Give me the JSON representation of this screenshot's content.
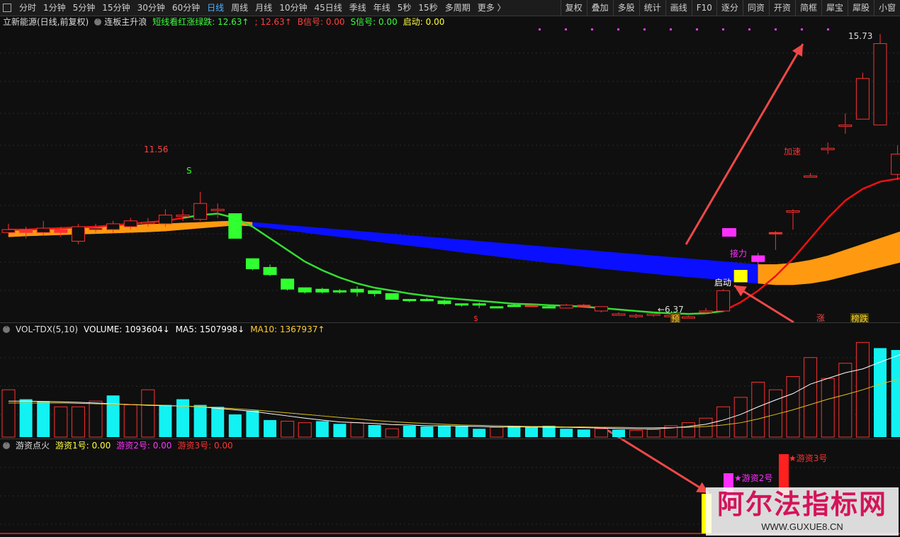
{
  "toolbar": {
    "periods": [
      "分时",
      "1分钟",
      "5分钟",
      "15分钟",
      "30分钟",
      "60分钟",
      "日线",
      "周线",
      "月线",
      "10分钟",
      "45日线",
      "季线",
      "年线",
      "5秒",
      "15秒",
      "多周期",
      "更多 〉"
    ],
    "active_period": "日线",
    "right_buttons": [
      "复权",
      "叠加",
      "多股",
      "统计",
      "画线",
      "F10",
      "逐分",
      "同资",
      "开资",
      "简框",
      "犀宝",
      "犀股",
      "小窗"
    ]
  },
  "main_panel": {
    "stock_title": "立新能源(日线,前复权)",
    "indicator_name": "连板主升浪",
    "fields": [
      {
        "label": "短线看红涨绿跌: 12.63↑",
        "color": "#3cff3c"
      },
      {
        "label": "; 12.63↑",
        "color": "#ff4040"
      },
      {
        "label": "B信号: 0.00",
        "color": "#ff4040"
      },
      {
        "label": "S信号: 0.00",
        "color": "#3cff3c"
      },
      {
        "label": "启动: 0.00",
        "color": "#ffff40"
      }
    ],
    "annotations": {
      "high_left": "11.56",
      "high_right": "15.73",
      "low": "6.37",
      "s_signal": "S",
      "s_marker": "$",
      "start": "启动",
      "relay": "接力",
      "accelerate": "加速",
      "pre": "预",
      "up": "涨",
      "list_down": "榜跌"
    }
  },
  "volume_panel": {
    "title": "VOL-TDX(5,10)",
    "volume": "VOLUME: 1093604↓",
    "ma5": "MA5: 1507998↓",
    "ma10": "MA10: 1367937↑"
  },
  "fire_panel": {
    "title": "游资点火",
    "f1": "游资1号: 0.00",
    "f2": "游资2号: 0.00",
    "f3": "游资3号: 0.00",
    "label2": "★游资2号",
    "label3": "★游资3号"
  },
  "watermark": {
    "main": "阿尔法指标网",
    "sub": "WWW.GUXUE8.CN"
  },
  "chart_data": {
    "type": "candlestick",
    "candles": [
      {
        "o": 8.9,
        "c": 9.0,
        "h": 9.2,
        "l": 8.8
      },
      {
        "o": 9.0,
        "c": 8.9,
        "h": 9.1,
        "l": 8.7
      },
      {
        "o": 8.9,
        "c": 9.05,
        "h": 9.3,
        "l": 8.8
      },
      {
        "o": 9.0,
        "c": 8.9,
        "h": 9.1,
        "l": 8.75
      },
      {
        "o": 8.6,
        "c": 9.1,
        "h": 9.2,
        "l": 8.5
      },
      {
        "o": 9.0,
        "c": 9.05,
        "h": 9.2,
        "l": 8.9
      },
      {
        "o": 9.0,
        "c": 9.2,
        "h": 9.3,
        "l": 8.9
      },
      {
        "o": 9.1,
        "c": 9.3,
        "h": 9.4,
        "l": 9.0
      },
      {
        "o": 9.2,
        "c": 9.25,
        "h": 9.4,
        "l": 9.1
      },
      {
        "o": 9.2,
        "c": 9.5,
        "h": 9.7,
        "l": 9.1
      },
      {
        "o": 9.5,
        "c": 9.5,
        "h": 9.7,
        "l": 9.3
      },
      {
        "o": 9.35,
        "c": 9.9,
        "h": 10.3,
        "l": 9.3
      },
      {
        "o": 9.7,
        "c": 9.7,
        "h": 9.9,
        "l": 9.4
      },
      {
        "o": 9.55,
        "c": 8.7,
        "h": 9.55,
        "l": 8.7
      },
      {
        "o": 8.0,
        "c": 7.65,
        "h": 8.0,
        "l": 7.6
      },
      {
        "o": 7.7,
        "c": 7.45,
        "h": 7.8,
        "l": 7.4
      },
      {
        "o": 7.3,
        "c": 6.95,
        "h": 7.3,
        "l": 6.9
      },
      {
        "o": 7.0,
        "c": 6.85,
        "h": 7.0,
        "l": 6.8
      },
      {
        "o": 6.95,
        "c": 6.85,
        "h": 7.0,
        "l": 6.8
      },
      {
        "o": 6.9,
        "c": 6.85,
        "h": 6.95,
        "l": 6.8
      },
      {
        "o": 6.95,
        "c": 6.85,
        "h": 7.05,
        "l": 6.7
      },
      {
        "o": 6.9,
        "c": 6.8,
        "h": 6.9,
        "l": 6.7
      },
      {
        "o": 6.8,
        "c": 6.6,
        "h": 6.8,
        "l": 6.6
      },
      {
        "o": 6.6,
        "c": 6.6,
        "h": 6.6,
        "l": 6.5
      },
      {
        "o": 6.6,
        "c": 6.55,
        "h": 6.65,
        "l": 6.55
      },
      {
        "o": 6.55,
        "c": 6.45,
        "h": 6.6,
        "l": 6.4
      },
      {
        "o": 6.45,
        "c": 6.4,
        "h": 6.45,
        "l": 6.35
      },
      {
        "o": 6.45,
        "c": 6.4,
        "h": 6.5,
        "l": 6.3
      },
      {
        "o": 6.35,
        "c": 6.35,
        "h": 6.35,
        "l": 6.3
      },
      {
        "o": 6.35,
        "c": 6.4,
        "h": 6.45,
        "l": 6.35
      },
      {
        "o": 6.4,
        "c": 6.35,
        "h": 6.4,
        "l": 6.35
      },
      {
        "o": 6.35,
        "c": 6.3,
        "h": 6.4,
        "l": 6.3
      },
      {
        "o": 6.3,
        "c": 6.4,
        "h": 6.45,
        "l": 6.3
      },
      {
        "o": 6.4,
        "c": 6.35,
        "h": 6.45,
        "l": 6.3
      },
      {
        "o": 6.2,
        "c": 6.35,
        "h": 6.35,
        "l": 6.15
      },
      {
        "o": 6.05,
        "c": 6.1,
        "h": 6.15,
        "l": 6.05
      },
      {
        "o": 6.0,
        "c": 6.05,
        "h": 6.1,
        "l": 5.95
      },
      {
        "o": 6.05,
        "c": 6.1,
        "h": 6.1,
        "l": 6.0
      },
      {
        "o": 6.0,
        "c": 6.05,
        "h": 6.1,
        "l": 5.95
      },
      {
        "o": 5.95,
        "c": 6.0,
        "h": 6.05,
        "l": 5.95
      },
      {
        "o": 6.15,
        "c": 6.2,
        "h": 6.3,
        "l": 6.1
      },
      {
        "o": 6.2,
        "c": 6.9,
        "h": 6.95,
        "l": 6.15
      },
      {
        "o": 7.6,
        "c": 7.2,
        "h": 7.6,
        "l": 7.2
      },
      {
        "o": 8.1,
        "c": 7.9,
        "h": 8.2,
        "l": 7.8
      },
      {
        "o": 8.9,
        "c": 8.85,
        "h": 8.95,
        "l": 8.3
      },
      {
        "o": 9.6,
        "c": 9.65,
        "h": 9.7,
        "l": 9.0
      },
      {
        "o": 10.85,
        "c": 10.85,
        "h": 10.95,
        "l": 10.8
      },
      {
        "o": 11.75,
        "c": 11.8,
        "h": 12.0,
        "l": 11.6
      },
      {
        "o": 12.6,
        "c": 12.6,
        "h": 13.0,
        "l": 12.3
      },
      {
        "o": 12.8,
        "c": 14.2,
        "h": 14.4,
        "l": 12.8
      },
      {
        "o": 12.6,
        "c": 15.4,
        "h": 15.73,
        "l": 12.6
      },
      {
        "o": 10.9,
        "c": 11.6,
        "h": 11.9,
        "l": 10.7
      },
      {
        "o": 11.3,
        "c": 11.0,
        "h": 11.6,
        "l": 10.9
      },
      {
        "o": 11.2,
        "c": 10.4,
        "h": 11.6,
        "l": 10.4
      }
    ],
    "candle_colors": [
      "r",
      "r",
      "r",
      "r",
      "r",
      "r",
      "r",
      "r",
      "r",
      "r",
      "r",
      "r",
      "r",
      "g",
      "g",
      "g",
      "g",
      "g",
      "g",
      "g",
      "g",
      "g",
      "g",
      "g",
      "g",
      "g",
      "g",
      "g",
      "g",
      "g",
      "r",
      "g",
      "r",
      "r",
      "r",
      "r",
      "r",
      "r",
      "r",
      "r",
      "r",
      "r",
      "y",
      "m",
      "r",
      "r",
      "r",
      "r",
      "r",
      "r",
      "r",
      "r",
      "r",
      "r"
    ],
    "ma_line": [
      9.0,
      9.0,
      9.03,
      9.05,
      9.08,
      9.1,
      9.15,
      9.2,
      9.25,
      9.3,
      9.4,
      9.5,
      9.55,
      9.4,
      9.1,
      8.7,
      8.3,
      7.9,
      7.6,
      7.35,
      7.15,
      7.0,
      6.9,
      6.8,
      6.72,
      6.65,
      6.6,
      6.55,
      6.5,
      6.45,
      6.43,
      6.4,
      6.38,
      6.35,
      6.3,
      6.25,
      6.2,
      6.15,
      6.12,
      6.1,
      6.12,
      6.2,
      6.5,
      6.9,
      7.4,
      8.0,
      8.7,
      9.4,
      10.0,
      10.4,
      10.65,
      10.75,
      10.8,
      10.8
    ],
    "cloud_upper": [
      8.95,
      9.0,
      9.02,
      9.05,
      9.08,
      9.1,
      9.13,
      9.15,
      9.18,
      9.2,
      9.23,
      9.25,
      9.28,
      9.3,
      9.25,
      9.2,
      9.15,
      9.1,
      9.05,
      9.0,
      8.95,
      8.9,
      8.85,
      8.8,
      8.75,
      8.7,
      8.65,
      8.6,
      8.55,
      8.5,
      8.45,
      8.4,
      8.35,
      8.3,
      8.25,
      8.2,
      8.15,
      8.1,
      8.05,
      8.0,
      7.95,
      7.9,
      7.85,
      7.8,
      7.8,
      7.85,
      7.95,
      8.1,
      8.3,
      8.5,
      8.7,
      8.9,
      9.1,
      9.3
    ],
    "cloud_lower": [
      8.75,
      8.78,
      8.8,
      8.82,
      8.84,
      8.86,
      8.88,
      8.9,
      8.92,
      8.95,
      9.0,
      9.05,
      9.1,
      9.15,
      9.12,
      9.05,
      8.98,
      8.9,
      8.82,
      8.75,
      8.68,
      8.6,
      8.52,
      8.45,
      8.38,
      8.3,
      8.22,
      8.15,
      8.08,
      8.0,
      7.93,
      7.86,
      7.8,
      7.73,
      7.66,
      7.6,
      7.54,
      7.48,
      7.42,
      7.37,
      7.32,
      7.27,
      7.2,
      7.15,
      7.1,
      7.1,
      7.15,
      7.25,
      7.4,
      7.55,
      7.7,
      7.85,
      8.0,
      8.15
    ],
    "volume": [
      1.25,
      1.0,
      0.95,
      0.8,
      0.8,
      0.95,
      1.1,
      0.85,
      1.25,
      0.85,
      1.0,
      0.85,
      0.8,
      0.6,
      0.7,
      0.45,
      0.42,
      0.38,
      0.42,
      0.35,
      0.38,
      0.32,
      0.22,
      0.3,
      0.28,
      0.3,
      0.3,
      0.22,
      0.26,
      0.3,
      0.28,
      0.3,
      0.22,
      0.2,
      0.22,
      0.2,
      0.18,
      0.2,
      0.3,
      0.38,
      0.5,
      0.8,
      1.05,
      1.45,
      1.25,
      1.6,
      2.1,
      1.55,
      1.95,
      2.5,
      2.35,
      2.3,
      2.3,
      2.1
    ],
    "vol_colors": [
      "r",
      "c",
      "c",
      "r",
      "r",
      "r",
      "c",
      "r",
      "r",
      "c",
      "c",
      "c",
      "c",
      "c",
      "c",
      "c",
      "r",
      "r",
      "c",
      "c",
      "r",
      "c",
      "r",
      "c",
      "c",
      "c",
      "c",
      "c",
      "r",
      "c",
      "c",
      "c",
      "c",
      "c",
      "r",
      "c",
      "r",
      "r",
      "r",
      "r",
      "r",
      "r",
      "r",
      "r",
      "r",
      "r",
      "r",
      "r",
      "r",
      "r",
      "c",
      "c",
      "r",
      "y"
    ],
    "vol_ma5": [
      0.95,
      0.95,
      0.94,
      0.93,
      0.92,
      0.9,
      0.88,
      0.86,
      0.84,
      0.83,
      0.82,
      0.8,
      0.76,
      0.72,
      0.68,
      0.62,
      0.56,
      0.5,
      0.45,
      0.4,
      0.38,
      0.36,
      0.33,
      0.32,
      0.3,
      0.3,
      0.29,
      0.28,
      0.27,
      0.27,
      0.27,
      0.26,
      0.26,
      0.25,
      0.24,
      0.23,
      0.22,
      0.22,
      0.24,
      0.28,
      0.34,
      0.45,
      0.6,
      0.8,
      0.98,
      1.15,
      1.4,
      1.55,
      1.7,
      1.8,
      1.98,
      2.15,
      2.35,
      2.2
    ],
    "vol_ma10": [
      0.9,
      0.9,
      0.9,
      0.9,
      0.89,
      0.88,
      0.87,
      0.86,
      0.85,
      0.84,
      0.82,
      0.8,
      0.78,
      0.75,
      0.72,
      0.68,
      0.64,
      0.6,
      0.56,
      0.52,
      0.48,
      0.44,
      0.41,
      0.38,
      0.36,
      0.34,
      0.32,
      0.31,
      0.3,
      0.29,
      0.28,
      0.28,
      0.27,
      0.27,
      0.26,
      0.26,
      0.25,
      0.25,
      0.25,
      0.26,
      0.28,
      0.32,
      0.38,
      0.48,
      0.6,
      0.72,
      0.86,
      1.0,
      1.12,
      1.25,
      1.4,
      1.52,
      1.62,
      1.7
    ]
  }
}
